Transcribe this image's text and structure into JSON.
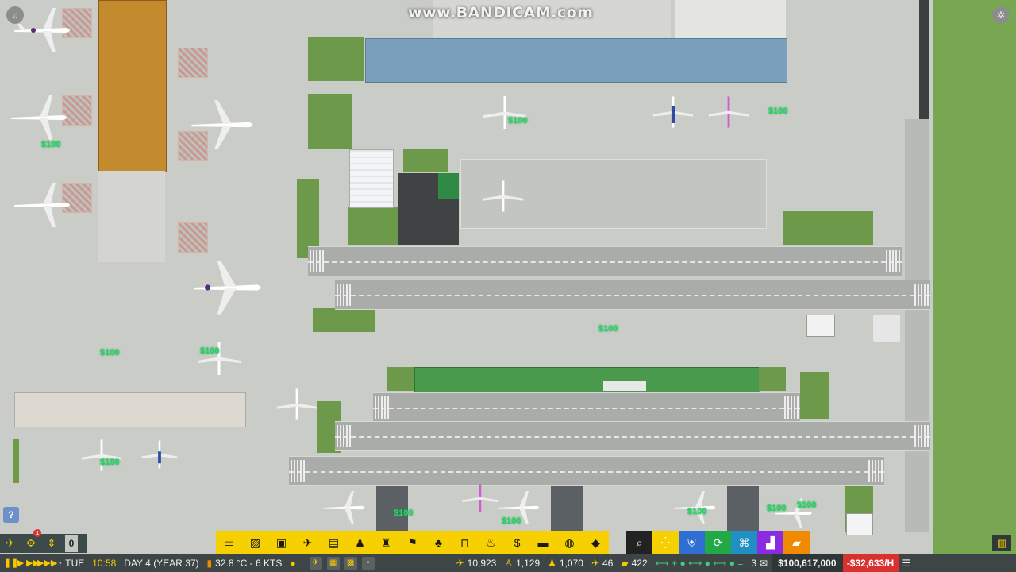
{
  "watermark": "www.BANDICAM.com",
  "map": {
    "money_labels": [
      "$100",
      "$100",
      "$100",
      "$100",
      "$100",
      "$100",
      "$100",
      "$100",
      "$100",
      "$100",
      "$100",
      "$100"
    ]
  },
  "help_label": "?",
  "left_tools": {
    "zero_label": "0",
    "notification_count": "1"
  },
  "build_toolbar": {
    "tools": [
      {
        "name": "conveyor",
        "icon": "▭"
      },
      {
        "name": "foundation",
        "icon": "▨"
      },
      {
        "name": "vehicles",
        "icon": "▣"
      },
      {
        "name": "aircraft",
        "icon": "✈"
      },
      {
        "name": "bus",
        "icon": "▤"
      },
      {
        "name": "staff",
        "icon": "♟"
      },
      {
        "name": "security",
        "icon": "♜"
      },
      {
        "name": "baggage",
        "icon": "⚑"
      },
      {
        "name": "cleaning",
        "icon": "♣"
      },
      {
        "name": "bench",
        "icon": "⊓"
      },
      {
        "name": "food",
        "icon": "♨"
      },
      {
        "name": "finance",
        "icon": "$"
      },
      {
        "name": "stands",
        "icon": "▬"
      },
      {
        "name": "fuel",
        "icon": "◍"
      },
      {
        "name": "layers",
        "icon": "◆"
      }
    ],
    "overlay_tools": [
      {
        "name": "search",
        "icon": "⌕",
        "bg": "#222222"
      },
      {
        "name": "grid",
        "icon": "⁛",
        "bg": "#f6d000"
      },
      {
        "name": "shield",
        "icon": "⛨",
        "bg": "#2f6fd3"
      },
      {
        "name": "refresh",
        "icon": "⟳",
        "bg": "#22a845"
      },
      {
        "name": "network",
        "icon": "⌘",
        "bg": "#1f8fc4"
      },
      {
        "name": "stairs",
        "icon": "▟",
        "bg": "#8a2be2"
      },
      {
        "name": "truck",
        "icon": "▰",
        "bg": "#f08a00"
      }
    ]
  },
  "status": {
    "day_of_week": "TUE",
    "time": "10:58",
    "day_label": "DAY 4 (YEAR 37)",
    "weather": "32.8 °C - 6 KTS",
    "flights": "10,923",
    "passengers": "1,129",
    "staff": "1,070",
    "aircraft": "46",
    "vehicles": "422",
    "mail_count": "3",
    "cash": "$100,617,000",
    "rate": "-$32,633/H"
  },
  "colors": {
    "toolbar_yellow": "#f6d000",
    "status_bar": "#3e4547",
    "negative_rate": "#d93030",
    "money_green": "#2fd06a"
  }
}
